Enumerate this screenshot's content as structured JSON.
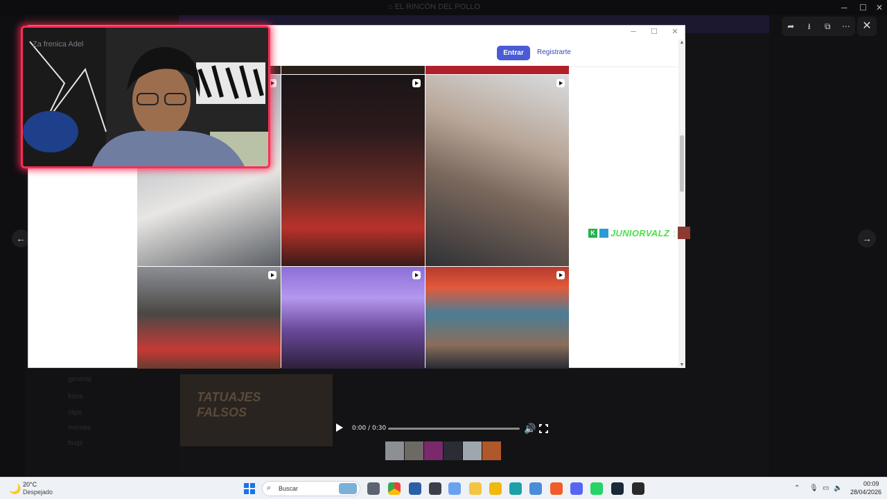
{
  "background": {
    "title": "EL RINCÓN DEL POLLO",
    "channels": [
      "general",
      "fotos",
      "clips",
      "memes",
      "bugs"
    ],
    "video_text": "TATUAJES FALSOS"
  },
  "viewer": {
    "tools": [
      "share-icon",
      "download-icon",
      "open-external-icon",
      "more-icon"
    ],
    "close": "✕",
    "prev": "←",
    "next": "→"
  },
  "browser": {
    "controls": [
      "─",
      "☐",
      "✕"
    ],
    "login_label": "Entrar",
    "register_label": "Registrarte",
    "scroll_up": "▲",
    "scroll_down": "▼"
  },
  "webcam": {
    "overlay_text": "Za frenica  Adel"
  },
  "chat_nick": {
    "badge": "K",
    "name": "JUNIORVALZ",
    "separator": ":"
  },
  "video_player": {
    "time": "0:00 / 0:30",
    "progress": 0.0
  },
  "taskbar": {
    "weather_temp": "20°C",
    "weather_desc": "Despejado",
    "search_placeholder": "Buscar",
    "time": "00:09",
    "date": "28/04/2026"
  },
  "colors": {
    "accent": "#4a5bd6",
    "webcam_border": "#ff2d55",
    "nick": "#4be04a"
  }
}
